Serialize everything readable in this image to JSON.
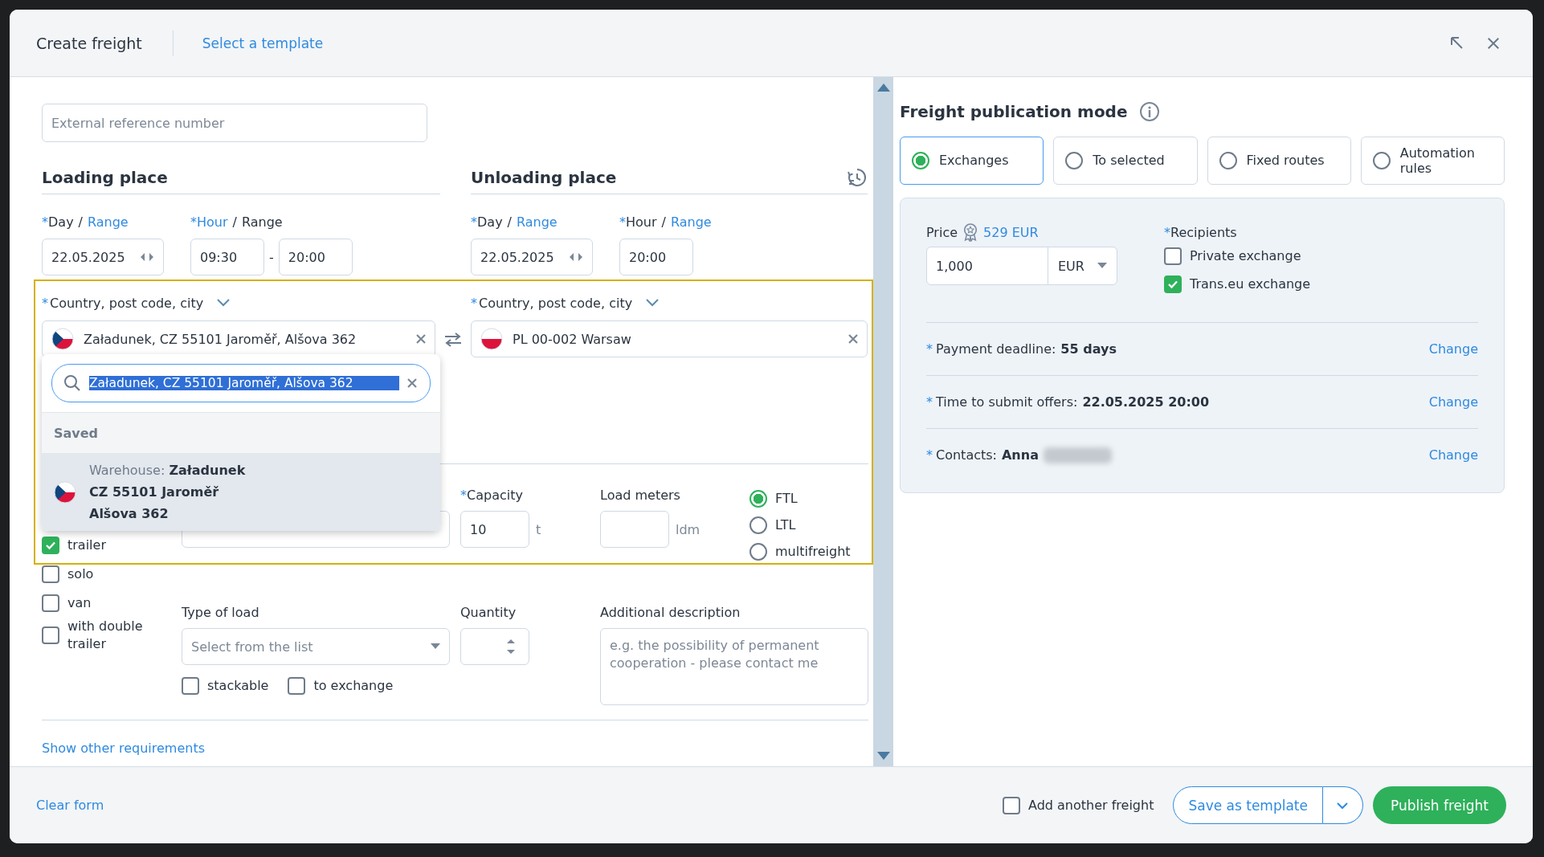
{
  "dialog": {
    "title": "Create freight",
    "template_link": "Select a template"
  },
  "external_reference": {
    "placeholder": "External reference number"
  },
  "places": [
    {
      "title": "Loading place",
      "day": {
        "asterisk": "*",
        "separator": "/",
        "options": [
          {
            "label": "Day",
            "selected": true
          },
          {
            "label": "Range",
            "selected": false
          }
        ]
      },
      "date": "22.05.2025",
      "hour": {
        "asterisk": "*",
        "separator": "/",
        "options": [
          {
            "label": "Hour",
            "selected": false
          },
          {
            "label": "Range",
            "selected": true
          }
        ]
      },
      "times": [
        "09:30",
        "20:00"
      ],
      "time_separator": "-",
      "location": {
        "asterisk": "*",
        "label": "Country, post code, city",
        "flag": {
          "kind": "cz"
        },
        "value": "Załadunek, CZ 55101 Jaroměř, Alšova 362"
      }
    },
    {
      "title": "Unloading place",
      "day": {
        "asterisk": "*",
        "separator": "/",
        "options": [
          {
            "label": "Day",
            "selected": true
          },
          {
            "label": "Range",
            "selected": false
          }
        ]
      },
      "date": "22.05.2025",
      "hour": {
        "asterisk": "*",
        "separator": "/",
        "options": [
          {
            "label": "Hour",
            "selected": true
          },
          {
            "label": "Range",
            "selected": false
          }
        ]
      },
      "times": [
        "20:00"
      ],
      "location": {
        "asterisk": "*",
        "label": "Country, post code, city",
        "flag": {
          "kind": "pl"
        },
        "value": "PL 00-002 Warsaw"
      }
    }
  ],
  "location_dropdown": {
    "search_value": "Załadunek, CZ 55101 Jaroměř, Alšova 362",
    "text_selected": true,
    "section": "Saved",
    "items": [
      {
        "flag": {
          "kind": "cz"
        },
        "prefix": "Warehouse:",
        "name": "Załadunek",
        "lines": [
          "CZ 55101 Jaroměř",
          "Alšova 362"
        ],
        "selected": true
      }
    ]
  },
  "vehicle_types": [
    {
      "label": "trailer",
      "checked": true
    },
    {
      "label": "solo",
      "checked": false
    },
    {
      "label": "van",
      "checked": false
    },
    {
      "label": "with double trailer",
      "checked": false
    }
  ],
  "capacity": {
    "asterisk": "*",
    "label": "Capacity",
    "value": "10",
    "unit": "t"
  },
  "load_meters": {
    "label": "Load meters",
    "unit": "ldm"
  },
  "load_modes": [
    {
      "label": "FTL",
      "selected": true
    },
    {
      "label": "LTL",
      "selected": false
    },
    {
      "label": "multifreight",
      "selected": false
    }
  ],
  "type_of_load": {
    "label": "Type of load",
    "placeholder": "Select from the list"
  },
  "quantity": {
    "label": "Quantity"
  },
  "load_flags": [
    {
      "label": "stackable",
      "checked": false
    },
    {
      "label": "to exchange",
      "checked": false
    }
  ],
  "description": {
    "label": "Additional description",
    "placeholder": "e.g. the possibility of permanent cooperation - please contact me"
  },
  "more_link": "Show other requirements",
  "publication": {
    "title": "Freight publication mode",
    "modes": [
      {
        "label": "Exchanges",
        "selected": true
      },
      {
        "label": "To selected",
        "selected": false
      },
      {
        "label": "Fixed routes",
        "selected": false
      },
      {
        "label": "Automation rules",
        "selected": false
      }
    ],
    "price": {
      "label": "Price",
      "suggested": "529 EUR",
      "value": "1,000",
      "currency": "EUR"
    },
    "recipients": {
      "asterisk": "*",
      "label": "Recipients",
      "options": [
        {
          "label": "Private exchange",
          "checked": false
        },
        {
          "label": "Trans.eu exchange",
          "checked": true
        }
      ]
    },
    "terms": [
      {
        "asterisk": "*",
        "label": "Payment deadline:",
        "value": "55 days",
        "action": "Change",
        "redacted": false
      },
      {
        "asterisk": "*",
        "label": "Time to submit offers:",
        "value": "22.05.2025 20:00",
        "action": "Change",
        "redacted": false
      },
      {
        "asterisk": "*",
        "label": "Contacts:",
        "value": "Anna",
        "action": "Change",
        "redacted": true
      }
    ]
  },
  "footer": {
    "clear": "Clear form",
    "add_another": {
      "label": "Add another freight",
      "checked": false
    },
    "save_template": "Save as template",
    "publish": "Publish freight"
  }
}
